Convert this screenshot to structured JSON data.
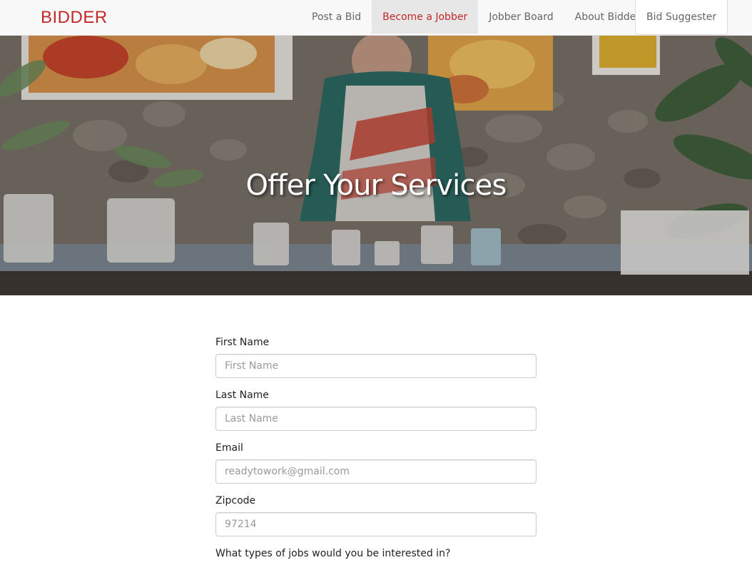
{
  "brand": "BIDDER",
  "nav": {
    "items": [
      {
        "label": "Post a Bid"
      },
      {
        "label": "Become a Jobber"
      },
      {
        "label": "Jobber Board"
      },
      {
        "label": "About Bidder"
      }
    ],
    "suggester_label": "Bid Suggester",
    "active_color": "#c0282a"
  },
  "hero": {
    "title": "Offer Your Services"
  },
  "form": {
    "first_name": {
      "label": "First Name",
      "placeholder": "First Name"
    },
    "last_name": {
      "label": "Last Name",
      "placeholder": "Last Name"
    },
    "email": {
      "label": "Email",
      "placeholder": "readytowork@gmail.com"
    },
    "zipcode": {
      "label": "Zipcode",
      "placeholder": "97214"
    },
    "jobs_question": "What types of jobs would you be interested in?"
  }
}
